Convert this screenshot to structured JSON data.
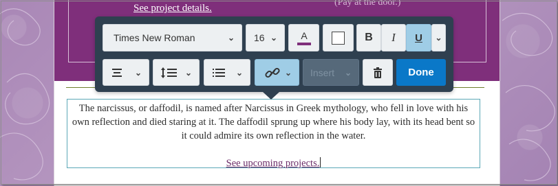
{
  "banner": {
    "link_label": "See project details.",
    "side_text": "(Pay at the door.)"
  },
  "content": {
    "paragraph": "The narcissus, or daffodil, is named after Narcissus in Greek mythology, who fell in love with his own reflection and died staring at it. The daffodil sprung up where his body lay, with its head bent so it could admire its own reflection in the water.",
    "link_label": "See upcoming projects."
  },
  "toolbar": {
    "font_family": "Times New Roman",
    "font_size": "16",
    "insert_label": "Insert",
    "done_label": "Done",
    "text_color_icon": "text-color-icon",
    "underline_active": true,
    "link_active": true,
    "accent_color": "#0a78c8",
    "active_color": "#9fcde6",
    "toolbar_color": "#2f4050",
    "banner_color": "#7f2f7b"
  }
}
